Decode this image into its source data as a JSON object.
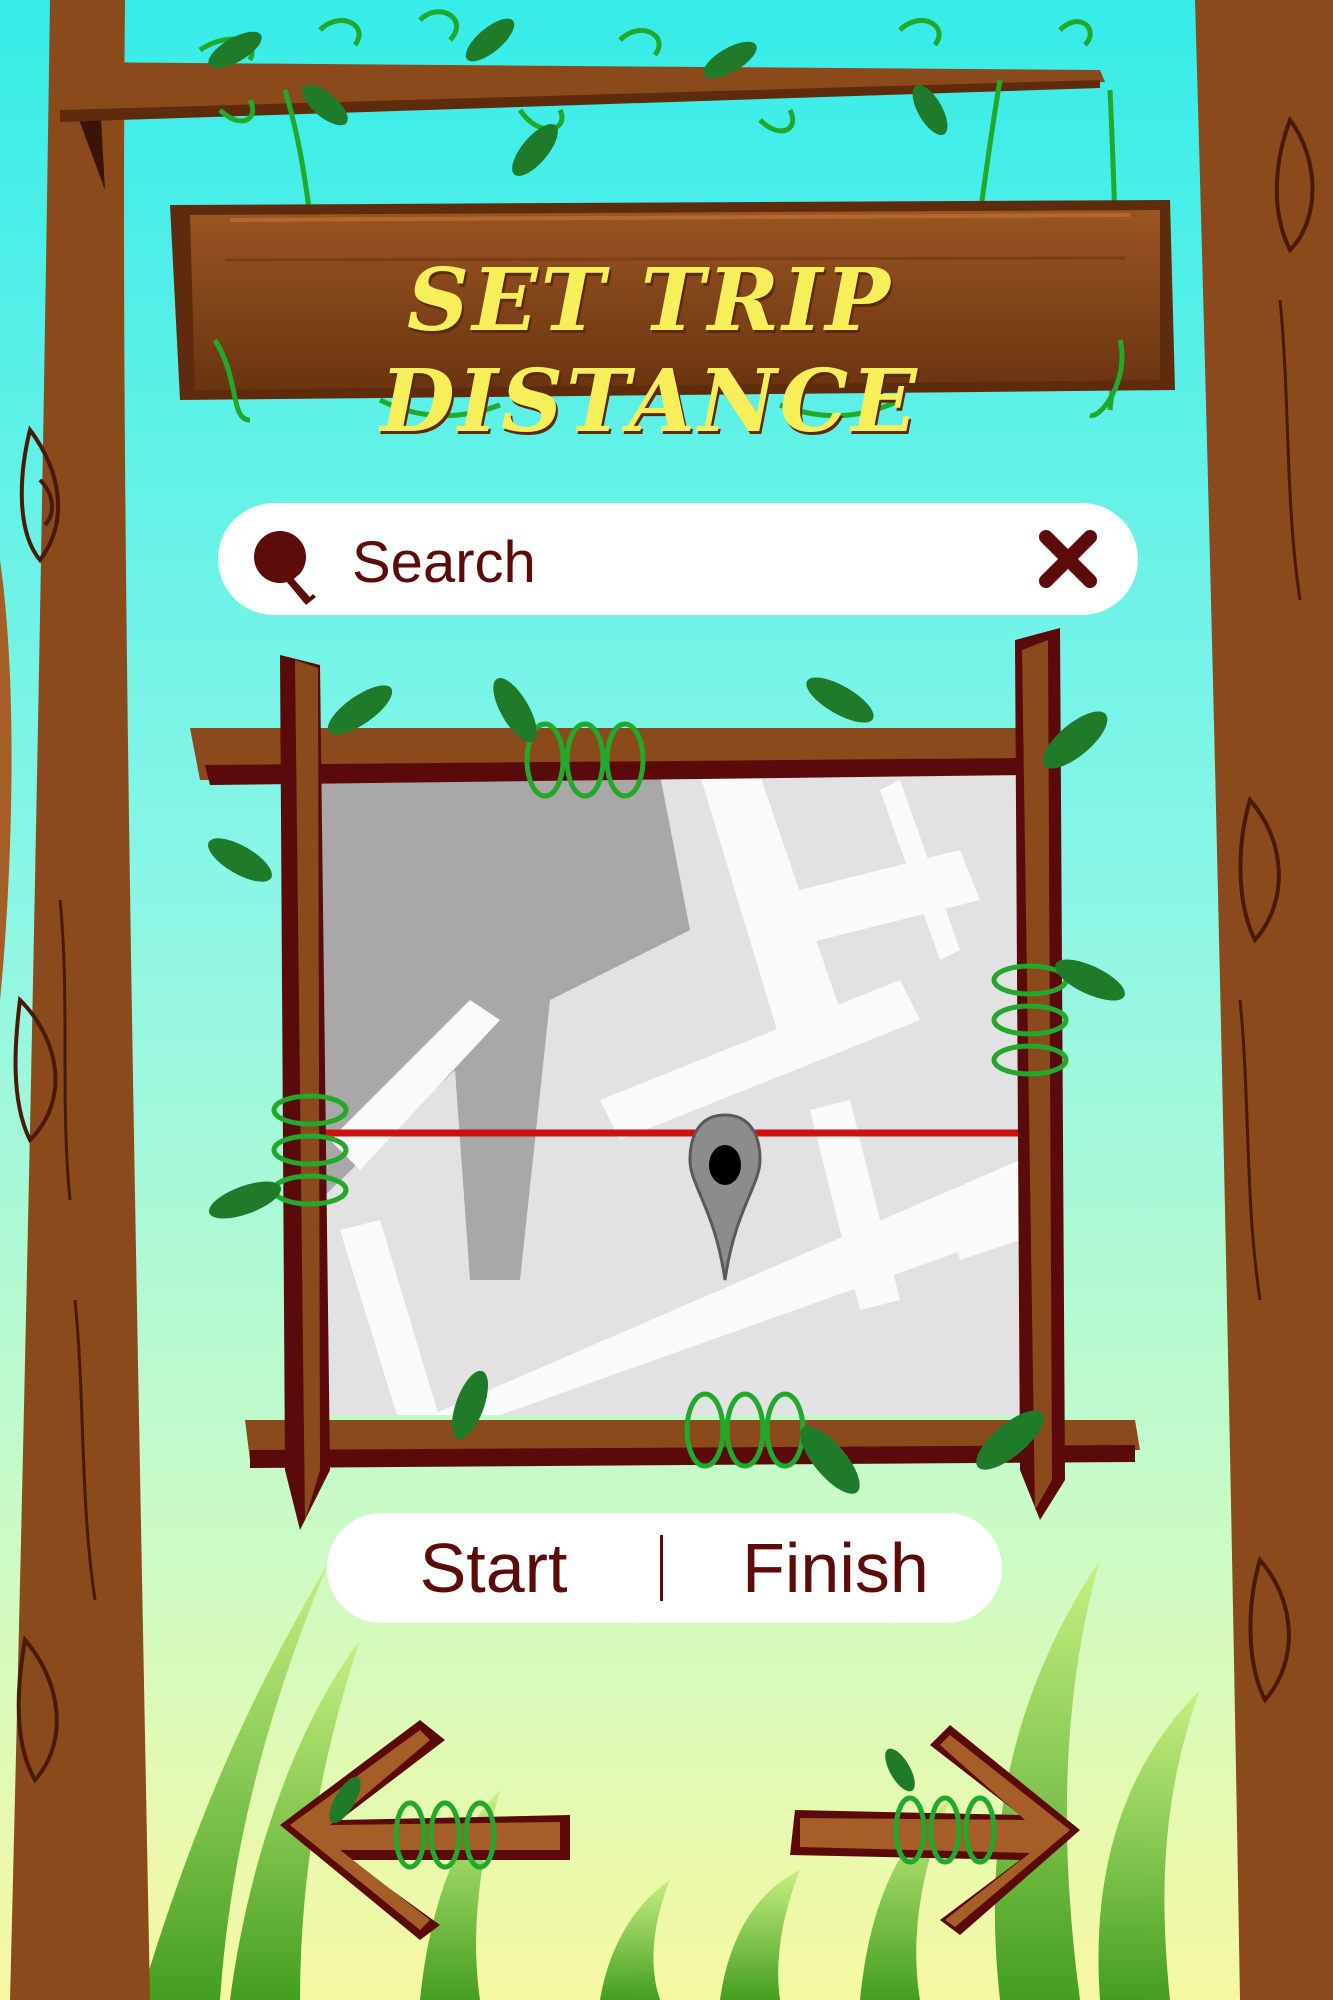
{
  "header": {
    "title": "SET TRIP DISTANCE"
  },
  "search": {
    "placeholder": "Search",
    "icon": "search-icon",
    "clear_icon": "close-icon"
  },
  "toggle": {
    "start_label": "Start",
    "finish_label": "Finish"
  },
  "navigation": {
    "back_icon": "arrow-left-icon",
    "next_icon": "arrow-right-icon"
  },
  "colors": {
    "sky_top": "#3cf0ea",
    "sky_bottom": "#f4f8a8",
    "wood": "#8a4a1c",
    "wood_dark": "#5a0a0a",
    "title_text": "#f6ef5a",
    "label_text": "#5c0a0a",
    "route_line": "#cc1111"
  }
}
